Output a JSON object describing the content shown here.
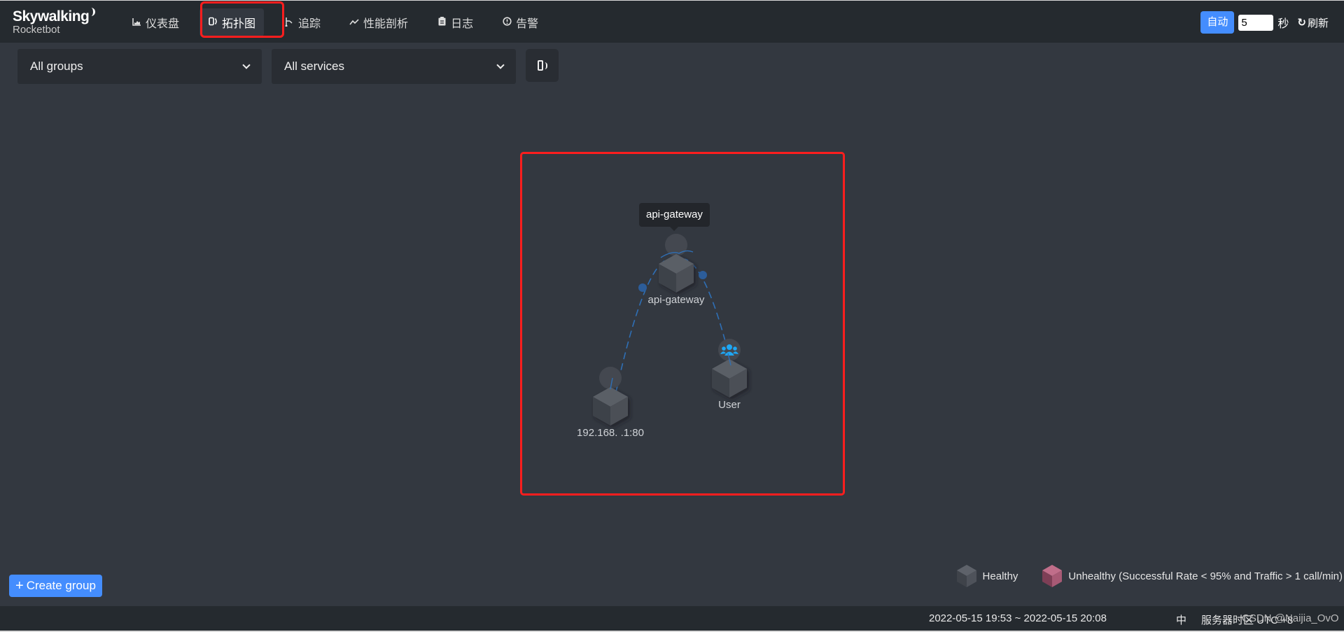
{
  "header": {
    "logo_main": "Skywalking",
    "logo_sub": "Rocketbot",
    "nav": [
      {
        "icon": "chart-icon",
        "glyph": "📊",
        "label": "仪表盘",
        "active": false
      },
      {
        "icon": "topology-icon",
        "glyph": "",
        "label": "拓扑图",
        "active": true
      },
      {
        "icon": "trace-icon",
        "glyph": "⊢",
        "label": "追踪",
        "active": false
      },
      {
        "icon": "trend-icon",
        "glyph": "〜",
        "label": "性能剖析",
        "active": false
      },
      {
        "icon": "clipboard-icon",
        "glyph": "▤",
        "label": "日志",
        "active": false
      },
      {
        "icon": "alert-circle-icon",
        "glyph": "ⓘ",
        "label": "告警",
        "active": false
      }
    ],
    "auto_label": "自动",
    "interval_value": "5",
    "seconds_label": "秒",
    "refresh_label": "刷新",
    "refresh_glyph": "↻"
  },
  "toolbar": {
    "group_select": "All groups",
    "service_select": "All services"
  },
  "topology": {
    "tooltip": "api-gateway",
    "nodes": [
      {
        "id": "api-gateway",
        "label": "api-gateway",
        "type": "service",
        "health": "healthy"
      },
      {
        "id": "backend",
        "label": "192.168.  .1:80",
        "type": "service",
        "health": "healthy"
      },
      {
        "id": "user",
        "label": "User",
        "type": "user",
        "health": "healthy"
      }
    ],
    "edges": [
      {
        "from": "api-gateway",
        "to": "backend"
      },
      {
        "from": "user",
        "to": "api-gateway"
      }
    ]
  },
  "legend": {
    "healthy": "Healthy",
    "unhealthy": "Unhealthy (Successful Rate < 95% and Traffic > 1 call/min)"
  },
  "create_group_label": "Create group",
  "footer": {
    "time_range": "2022-05-15 19:53 ~ 2022-05-15 20:08",
    "lang": "中",
    "timezone": "服务器时区 UTC +8",
    "watermark": "CSDN @Naijia_OvO"
  },
  "colors": {
    "accent": "#448dfe",
    "highlight": "#ff1e1e",
    "healthy": "#4e525a",
    "unhealthy": "#a85a75",
    "edge": "#2f6fb5",
    "user_icon": "#1ea7f4"
  }
}
